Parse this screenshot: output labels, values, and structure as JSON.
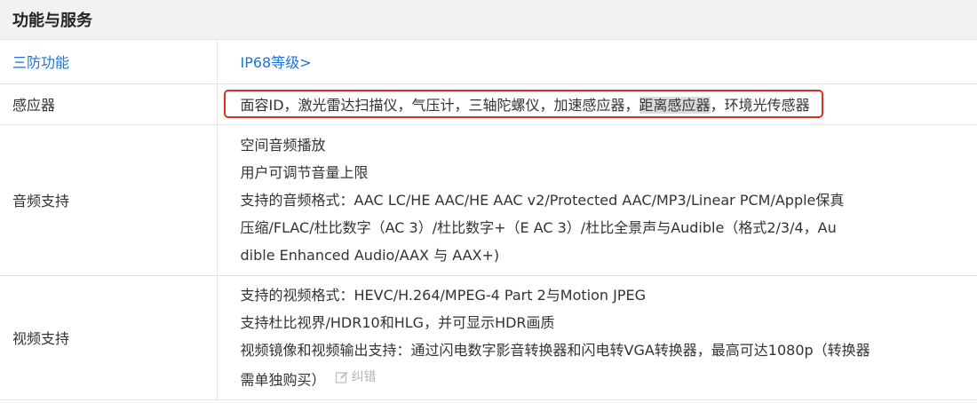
{
  "section": {
    "title": "功能与服务"
  },
  "rows": [
    {
      "label": "三防功能",
      "link": "IP68等级>"
    },
    {
      "label": "感应器",
      "parts": [
        "面容ID，激光雷达扫描仪，气压计，三轴陀螺仪，加速感应器，",
        "距离感应器",
        "，环境光传感器"
      ]
    },
    {
      "label": "音频支持",
      "lines": [
        "空间音频播放",
        "用户可调节音量上限",
        "支持的音频格式：AAC LC/HE AAC/HE AAC v2/Protected AAC/MP3/Linear PCM/Apple保真",
        "压缩/FLAC/杜比数字（AC 3）/杜比数字+（E AC 3）/杜比全景声与Audible（格式2/3/4，Au",
        "dible Enhanced Audio/AAX 与 AAX+)"
      ]
    },
    {
      "label": "视频支持",
      "lines": [
        "支持的视频格式：HEVC/H.264/MPEG-4 Part 2与Motion JPEG",
        "支持杜比视界/HDR10和HLG，并可显示HDR画质",
        "视频镜像和视频输出支持：通过闪电数字影音转换器和闪电转VGA转换器，最高可达1080p（转换器",
        "需单独购买）"
      ],
      "edit_label": "纠错"
    }
  ],
  "colors": {
    "link": "#1e73d8",
    "highlight_border": "#d93025",
    "selection": "#dcdcdc"
  },
  "icons": {
    "edit": "pencil-edit-icon"
  }
}
